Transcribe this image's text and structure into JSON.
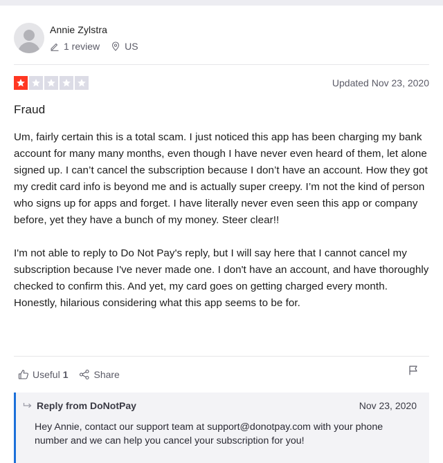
{
  "consumer": {
    "name": "Annie Zylstra",
    "review_count": "1 review",
    "country": "US"
  },
  "review": {
    "rating": 1,
    "max_rating": 5,
    "star_color": "#ff3722",
    "empty_star_color": "#dcdce6",
    "date": "Updated Nov 23, 2020",
    "title": "Fraud",
    "paragraphs": [
      "Um, fairly certain this is a total scam. I just noticed this app has been charging my bank account for many many months, even though I have never even heard of them, let alone signed up. I can’t cancel the subscription because I don’t have an account. How they got my credit card info is beyond me and is actually super creepy. I’m not the kind of person who signs up for apps and forget. I have literally never even seen this app or company before, yet they have a bunch of my money. Steer clear!!",
      "I'm not able to reply to Do Not Pay's reply, but I will say here that I cannot cancel my subscription because I've never made one. I don't have an account, and have thoroughly checked to confirm this. And yet, my card goes on getting charged every month. Honestly, hilarious considering what this app seems to be for."
    ]
  },
  "actions": {
    "useful_label": "Useful",
    "useful_count": "1",
    "share_label": "Share"
  },
  "reply": {
    "from": "Reply from DoNotPay",
    "date": "Nov 23, 2020",
    "text": "Hey Annie, contact our support team at support@donotpay.com with your phone number and we can help you cancel your subscription for you!",
    "accent_color": "#1b6fd9"
  },
  "icons": {
    "avatar": "user-avatar",
    "review_count": "pencil-icon",
    "country": "location-pin-icon",
    "useful": "thumbs-up-icon",
    "share": "share-icon",
    "flag": "flag-icon",
    "reply": "reply-arrow-icon"
  }
}
